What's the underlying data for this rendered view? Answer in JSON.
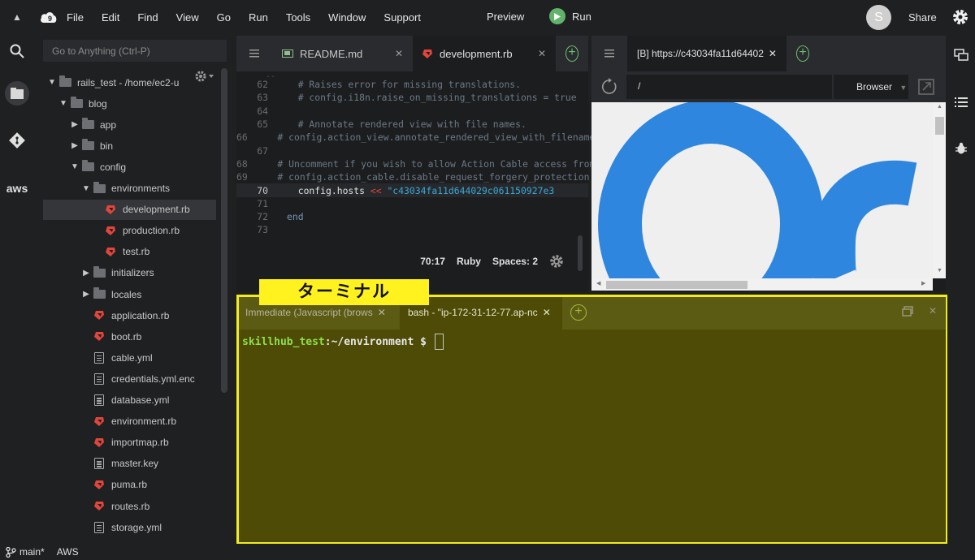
{
  "menubar": {
    "items": [
      "File",
      "Edit",
      "Find",
      "View",
      "Go",
      "Run",
      "Tools",
      "Window",
      "Support"
    ],
    "preview": "Preview",
    "run": "Run",
    "avatar_letter": "S",
    "share": "Share"
  },
  "activity_icons": [
    "search-icon",
    "files-icon",
    "git-icon",
    "aws-icon"
  ],
  "aws_label": "aws",
  "tree": {
    "goto_placeholder": "Go to Anything (Ctrl-P)",
    "rows": [
      {
        "label": "rails_test - /home/ec2-u",
        "type": "folder",
        "depth": 0,
        "arrow": "▼"
      },
      {
        "label": "blog",
        "type": "folder",
        "depth": 1,
        "arrow": "▼"
      },
      {
        "label": "app",
        "type": "folder",
        "depth": 2,
        "arrow": "▶"
      },
      {
        "label": "bin",
        "type": "folder",
        "depth": 2,
        "arrow": "▶"
      },
      {
        "label": "config",
        "type": "folder",
        "depth": 2,
        "arrow": "▼"
      },
      {
        "label": "environments",
        "type": "folder",
        "depth": 3,
        "arrow": "▼"
      },
      {
        "label": "development.rb",
        "type": "ruby",
        "depth": 4,
        "arrow": "",
        "selected": true
      },
      {
        "label": "production.rb",
        "type": "ruby",
        "depth": 4,
        "arrow": ""
      },
      {
        "label": "test.rb",
        "type": "ruby",
        "depth": 4,
        "arrow": ""
      },
      {
        "label": "initializers",
        "type": "folder",
        "depth": 3,
        "arrow": "▶"
      },
      {
        "label": "locales",
        "type": "folder",
        "depth": 3,
        "arrow": "▶"
      },
      {
        "label": "application.rb",
        "type": "ruby",
        "depth": 3,
        "arrow": ""
      },
      {
        "label": "boot.rb",
        "type": "ruby",
        "depth": 3,
        "arrow": ""
      },
      {
        "label": "cable.yml",
        "type": "doc",
        "depth": 3,
        "arrow": ""
      },
      {
        "label": "credentials.yml.enc",
        "type": "doc",
        "depth": 3,
        "arrow": ""
      },
      {
        "label": "database.yml",
        "type": "doc",
        "depth": 3,
        "arrow": ""
      },
      {
        "label": "environment.rb",
        "type": "ruby",
        "depth": 3,
        "arrow": ""
      },
      {
        "label": "importmap.rb",
        "type": "ruby",
        "depth": 3,
        "arrow": ""
      },
      {
        "label": "master.key",
        "type": "doc",
        "depth": 3,
        "arrow": ""
      },
      {
        "label": "puma.rb",
        "type": "ruby",
        "depth": 3,
        "arrow": ""
      },
      {
        "label": "routes.rb",
        "type": "ruby",
        "depth": 3,
        "arrow": ""
      },
      {
        "label": "storage.yml",
        "type": "doc",
        "depth": 3,
        "arrow": ""
      }
    ]
  },
  "editor": {
    "tabs": [
      {
        "label": "README.md",
        "icon": "markdown-icon",
        "active": false
      },
      {
        "label": "development.rb",
        "icon": "ruby-icon",
        "active": true
      }
    ],
    "lines": [
      {
        "n": "62",
        "text": "  # Raises error for missing translations."
      },
      {
        "n": "63",
        "text": "  # config.i18n.raise_on_missing_translations = true"
      },
      {
        "n": "64",
        "text": ""
      },
      {
        "n": "65",
        "text": "  # Annotate rendered view with file names."
      },
      {
        "n": "66",
        "text": "  # config.action_view.annotate_rendered_view_with_filenames = true"
      },
      {
        "n": "67",
        "text": ""
      },
      {
        "n": "68",
        "text": "  # Uncomment if you wish to allow Action Cable access from any origin."
      },
      {
        "n": "69",
        "text": "  # config.action_cable.disable_request_forgery_protection = true"
      },
      {
        "n": "70",
        "text": "",
        "current": true
      },
      {
        "n": "71",
        "text": ""
      },
      {
        "n": "72",
        "text": "end"
      },
      {
        "n": "73",
        "text": ""
      }
    ],
    "line70": {
      "code": "  config.hosts ",
      "op": "<<",
      "str": " \"c43034fa11d644029c061150927e3"
    },
    "status": {
      "position": "70:17",
      "language": "Ruby",
      "spaces": "Spaces: 2"
    }
  },
  "browser": {
    "tab_label": "[B] https://c43034fa11d64402",
    "url": "/",
    "mode": "Browser"
  },
  "callout": "ターミナル",
  "terminal": {
    "tabs": [
      {
        "label": "Immediate (Javascript (brows",
        "active": false
      },
      {
        "label": "bash - \"ip-172-31-12-77.ap-nc",
        "active": true
      }
    ],
    "prompt_user": "skillhub_test",
    "prompt_path": ":~/environment",
    "prompt_symbol": " $ "
  },
  "statusbar": {
    "branch": "main*",
    "aws": "AWS"
  },
  "colors": {
    "highlight": "#fff21e",
    "terminal_bg": "#4d4b05",
    "ruby": "#e0463c",
    "run": "#5fb36a"
  }
}
